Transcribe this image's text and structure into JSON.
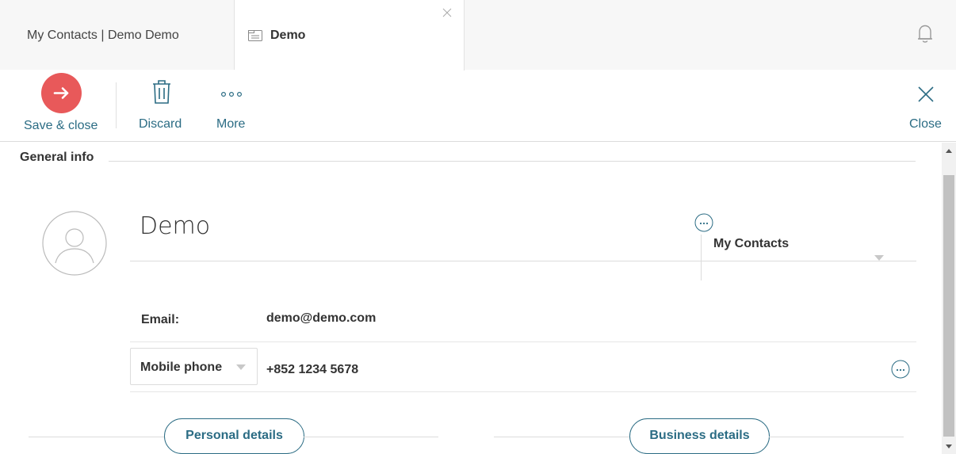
{
  "tabs": {
    "first_label": "My Contacts | Demo Demo",
    "active_label": "Demo"
  },
  "toolbar": {
    "save_label": "Save & close",
    "discard_label": "Discard",
    "more_label": "More",
    "close_label": "Close"
  },
  "form": {
    "section_title": "General info",
    "name_value": "Demo",
    "folder_value": "My Contacts",
    "email_label": "Email:",
    "email_value": "demo@demo.com",
    "phone_type": "Mobile phone",
    "phone_value": "+852 1234 5678",
    "personal_details_label": "Personal details",
    "business_details_label": "Business details"
  },
  "colors": {
    "accent": "#2b6c84",
    "save_button": "#e8595a"
  },
  "icons": [
    "contact-card-icon",
    "tab-close-icon",
    "bell-icon",
    "arrow-right-icon",
    "trash-icon",
    "more-dots-icon",
    "close-icon",
    "avatar-icon",
    "ellipsis-icon",
    "caret-down-icon"
  ]
}
